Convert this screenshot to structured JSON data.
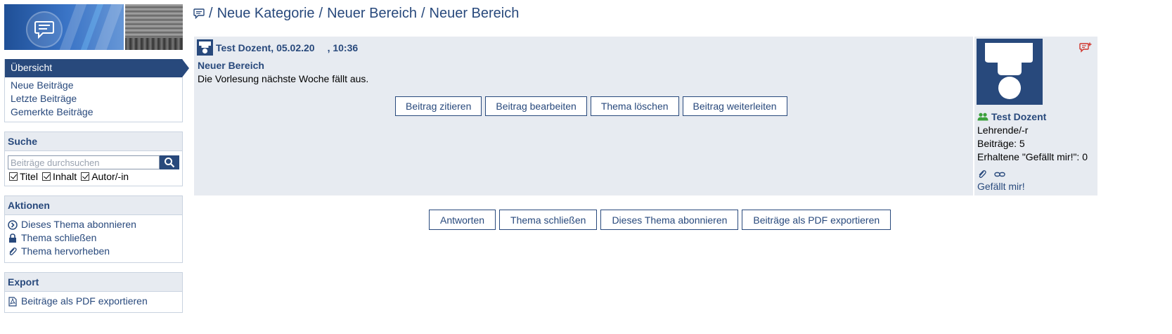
{
  "sidebar": {
    "nav": {
      "active": "Übersicht",
      "items": [
        "Neue Beiträge",
        "Letzte Beiträge",
        "Gemerkte Beiträge"
      ]
    },
    "search": {
      "title": "Suche",
      "placeholder": "Beiträge durchsuchen",
      "options": [
        "Titel",
        "Inhalt",
        "Autor/-in"
      ]
    },
    "actions": {
      "title": "Aktionen",
      "items": [
        {
          "label": "Dieses Thema abonnieren",
          "icon": "subscribe-icon"
        },
        {
          "label": "Thema schließen",
          "icon": "lock-icon"
        },
        {
          "label": "Thema hervorheben",
          "icon": "paperclip-icon"
        }
      ]
    },
    "export": {
      "title": "Export",
      "items": [
        {
          "label": "Beiträge als PDF exportieren",
          "icon": "pdf-icon"
        }
      ]
    }
  },
  "breadcrumb": {
    "items": [
      "Neue Kategorie",
      "Neuer Bereich",
      "Neuer Bereich"
    ],
    "separator": "/"
  },
  "post": {
    "author_date": "Test Dozent, 05.02.20",
    "time": ", 10:36",
    "title": "Neuer Bereich",
    "body": "Die Vorlesung nächste Woche fällt aus.",
    "buttons": [
      "Beitrag zitieren",
      "Beitrag bearbeiten",
      "Thema löschen",
      "Beitrag weiterleiten"
    ],
    "author": {
      "name": "Test Dozent",
      "role": "Lehrende/-r",
      "posts": "Beiträge: 5",
      "likes": "Erhaltene \"Gefällt mir!\": 0",
      "like_link": "Gefällt mir!"
    }
  },
  "bottom_buttons": [
    "Antworten",
    "Thema schließen",
    "Dieses Thema abonnieren",
    "Beiträge als PDF exportieren"
  ],
  "colors": {
    "primary": "#28497c",
    "panel": "#e7ebf1",
    "accent_red": "#d0342c",
    "group_green": "#3aa03a"
  }
}
